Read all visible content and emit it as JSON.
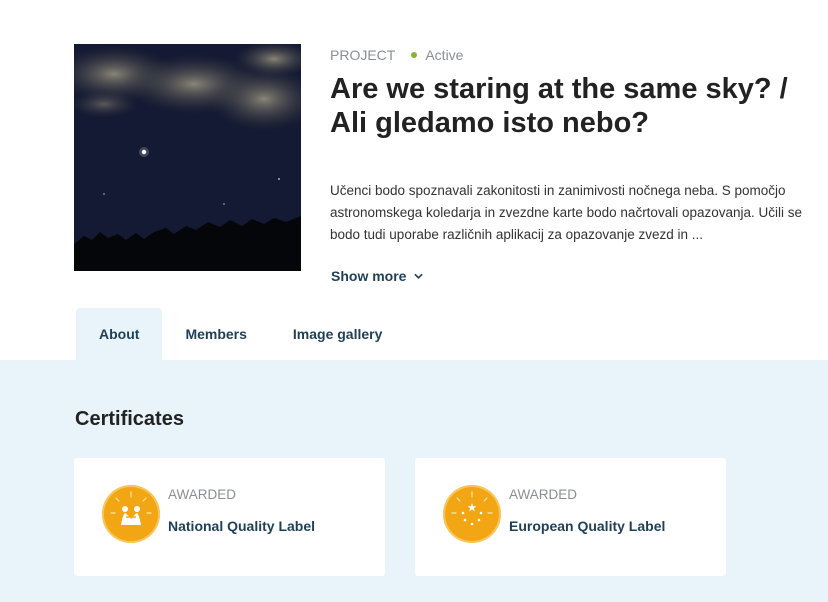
{
  "project": {
    "type_label": "PROJECT",
    "status": "Active",
    "status_color": "#8ab42a",
    "title": "Are we staring at the same sky? / Ali gledamo isto nebo?",
    "description": "Učenci bodo spoznavali zakonitosti in zanimivosti nočnega neba. S pomočjo astronomskega koledarja in zvezdne karte bodo načrtovali opazovanja. Učili se bodo tudi uporabe različnih aplikacij za opazovanje zvezd in ...",
    "show_more": "Show more",
    "show_more_icon": "chevron-down-icon"
  },
  "tabs": [
    {
      "label": "About",
      "active": true
    },
    {
      "label": "Members",
      "active": false
    },
    {
      "label": "Image gallery",
      "active": false
    }
  ],
  "certificates": {
    "heading": "Certificates",
    "items": [
      {
        "status": "AWARDED",
        "name": "National Quality Label",
        "icon": "national-quality-icon",
        "color": "#f2a614"
      },
      {
        "status": "AWARDED",
        "name": "European Quality Label",
        "icon": "european-quality-icon",
        "color": "#f2a614"
      }
    ]
  },
  "colors": {
    "accent": "#1f3f57",
    "panel_bg": "#e8f4fa"
  }
}
